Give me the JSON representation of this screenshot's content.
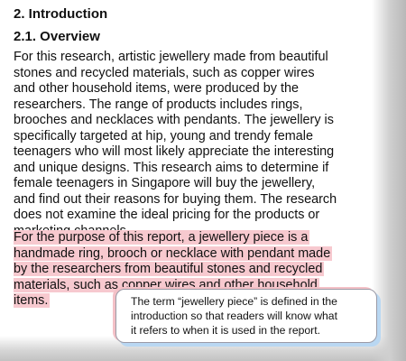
{
  "section": {
    "heading": "2. Introduction",
    "subheading": "2.1. Overview"
  },
  "body": {
    "paragraph_1_lines": [
      "For this research, artistic jewellery made from beautiful",
      "stones and recycled materials, such as copper wires",
      "and other household items, were produced by the",
      "researchers. The range of products includes rings,",
      "brooches and necklaces with pendants. The jewellery is",
      "specifically targeted at hip, young and trendy female",
      "teenagers who will most likely appreciate the interesting",
      "and unique designs. This research aims to determine if",
      "female teenagers in Singapore will buy the jewellery,",
      "and find out their reasons for buying them. The research",
      "does not examine the ideal pricing for the products or",
      "marketing channels."
    ],
    "paragraph_2_lines": [
      "For the purpose of this report, a jewellery piece is a",
      "handmade ring, brooch or necklace with pendant made",
      "by the researchers from beautiful stones and recycled",
      "materials, such as copper wires and other household",
      "items."
    ]
  },
  "callout": {
    "lines": [
      "The term “jewellery piece” is defined in the",
      "introduction so that readers will know what",
      "it refers to when it is used in the report."
    ]
  },
  "colors": {
    "highlight": "#f7c9cf",
    "callout_shadow_blue": "#b9d7f2",
    "callout_shadow_pink": "#f4c1c7"
  }
}
